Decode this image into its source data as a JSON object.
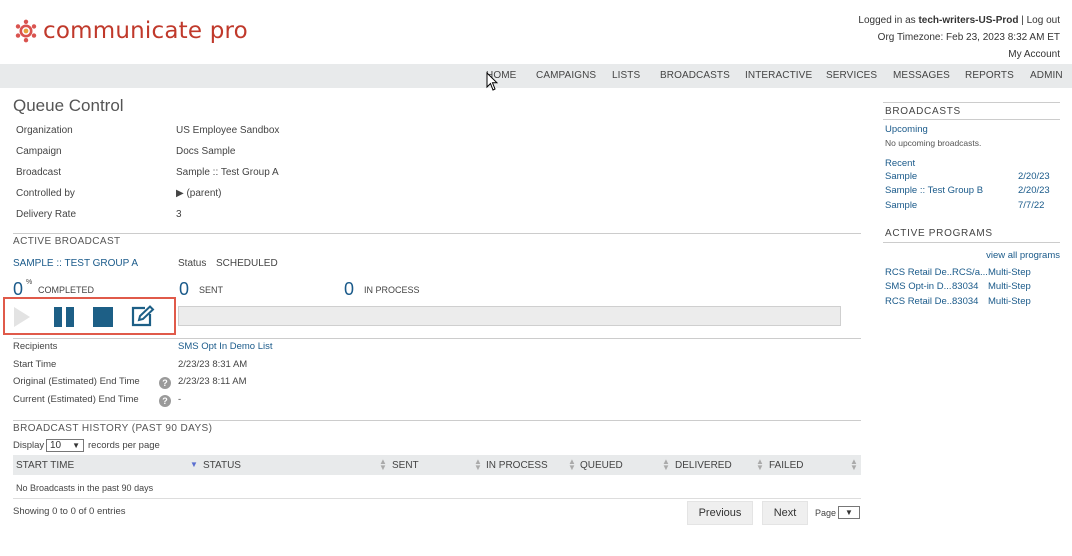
{
  "header": {
    "brand": "communicate pro",
    "logged_in_prefix": "Logged in as ",
    "user": "tech-writers-US-Prod",
    "separator": " | ",
    "logout": "Log out",
    "timezone": "Org Timezone: Feb 23, 2023 8:32 AM ET",
    "my_account": "My Account",
    "brand_color": "#c0392b"
  },
  "nav": [
    "HOME",
    "CAMPAIGNS",
    "LISTS",
    "BROADCASTS",
    "INTERACTIVE",
    "SERVICES",
    "MESSAGES",
    "REPORTS",
    "ADMIN"
  ],
  "page": {
    "title": "Queue Control",
    "info": [
      {
        "label": "Organization",
        "value": "US Employee Sandbox"
      },
      {
        "label": "Campaign",
        "value": "Docs Sample"
      },
      {
        "label": "Broadcast",
        "value": "Sample :: Test Group A"
      },
      {
        "label": "Controlled by",
        "value": "▶ (parent)"
      },
      {
        "label": "Delivery Rate",
        "value": "3"
      }
    ]
  },
  "active": {
    "heading": "ACTIVE BROADCAST",
    "name": "SAMPLE :: TEST GROUP A",
    "status_label": "Status",
    "status_value": "SCHEDULED",
    "completed_num": "0",
    "completed_unit": "%",
    "completed_label": "COMPLETED",
    "sent_num": "0",
    "sent_label": "SENT",
    "inprocess_num": "0",
    "inprocess_label": "IN PROCESS",
    "progress": 0,
    "accent": "#1a5a8a",
    "highlight": "#e05a4a"
  },
  "details": [
    {
      "label": "Recipients",
      "value": "SMS Opt In Demo List",
      "help": false
    },
    {
      "label": "Start Time",
      "value": "2/23/23 8:31 AM",
      "help": false
    },
    {
      "label": "Original (Estimated) End Time",
      "value": "2/23/23 8:11 AM",
      "help": true
    },
    {
      "label": "Current (Estimated) End Time",
      "value": "-",
      "help": true
    }
  ],
  "history": {
    "heading": "BROADCAST HISTORY (PAST 90 DAYS)",
    "display": "Display",
    "per_page_value": "10",
    "per_page_label": "records per page",
    "columns": [
      "START TIME",
      "STATUS",
      "SENT",
      "IN PROCESS",
      "QUEUED",
      "DELIVERED",
      "FAILED"
    ],
    "empty": "No Broadcasts in the past 90 days",
    "showing": "Showing 0 to 0 of 0 entries",
    "previous": "Previous",
    "next": "Next",
    "page": "Page"
  },
  "sidebar": {
    "broadcasts_heading": "BROADCASTS",
    "upcoming": "Upcoming",
    "no_upcoming": "No upcoming broadcasts.",
    "recent": "Recent",
    "recent_items": [
      {
        "name": "Sample",
        "date": "2/20/23"
      },
      {
        "name": "Sample :: Test Group B",
        "date": "2/20/23"
      },
      {
        "name": "Sample",
        "date": "7/7/22"
      }
    ],
    "programs_heading": "ACTIVE PROGRAMS",
    "view_all": "view all programs",
    "programs": [
      {
        "name": "RCS Retail De...",
        "code": "RCS/a...",
        "type": "Multi-Step"
      },
      {
        "name": "SMS Opt-in D...",
        "code": "83034",
        "type": "Multi-Step"
      },
      {
        "name": "RCS Retail De...",
        "code": "83034",
        "type": "Multi-Step"
      }
    ]
  }
}
